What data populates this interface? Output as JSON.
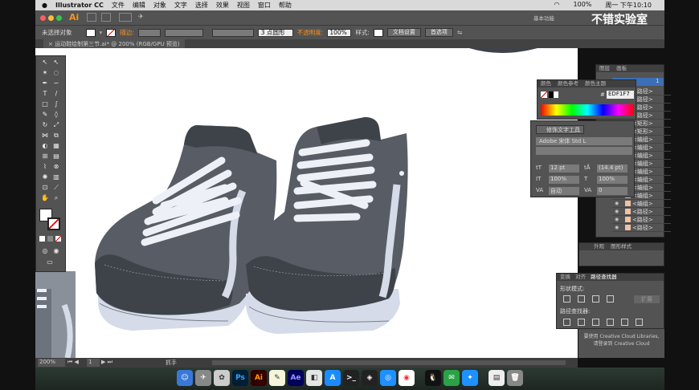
{
  "menubar": {
    "apple": "",
    "app_name": "Illustrator CC",
    "items": [
      "文件",
      "编辑",
      "对象",
      "文字",
      "选择",
      "效果",
      "视图",
      "窗口",
      "帮助"
    ],
    "battery": "100%",
    "clock": "周一 下午10:10"
  },
  "appbar": {
    "logo": "Ai",
    "workspace": "基本功能"
  },
  "control": {
    "selection_label": "未选择对象",
    "stroke_label": "描边:",
    "brush_label": "3 点圆形",
    "opacity_label": "不透明度:",
    "opacity_value": "100%",
    "style_label": "样式:",
    "doc_setup": "文档设置",
    "preferences": "首选项"
  },
  "doc_tab": {
    "title": "运动鞋绘制第三节.ai* @ 200% (RGB/GPU 预览)"
  },
  "color_panel": {
    "tabs": [
      "颜色",
      "颜色参考",
      "颜色主题"
    ],
    "hex_label": "#",
    "hex_value": "EDF1F7"
  },
  "char_panel": {
    "touchup": "修饰文字工具",
    "font": "Adobe 宋体 Std L",
    "size": "12 pt",
    "leading": "(14.4 pt)",
    "scale_v": "100%",
    "scale_h": "100%",
    "kerning": "自动",
    "tracking": "0"
  },
  "layers_panel": {
    "tabs": [
      "图层",
      "画板"
    ],
    "header": "1",
    "rows": [
      "<路径>",
      "<路径>",
      "<路径>",
      "<路径>",
      "<矩形>",
      "<矩形>",
      "<编组>",
      "<编组>",
      "<编组>",
      "<编组>",
      "<编组>",
      "<编组>",
      "<编组>",
      "<编组>",
      "<编组>",
      "<路径>",
      "<路径>",
      "<路径>",
      "<路径>"
    ]
  },
  "transparency_panel": {
    "tabs": [
      "外观",
      "图形样式"
    ]
  },
  "pathfinder_panel": {
    "tabs": [
      "变换",
      "对齐",
      "路径查找器"
    ],
    "shape_modes": "形状模式:",
    "pathfinders": "路径查找器:",
    "expand": "扩展"
  },
  "cc_libraries": {
    "line1": "要使用 Creative Cloud Libraries,",
    "line2": "请登录到 Creative Cloud"
  },
  "statusbar": {
    "zoom": "200%",
    "page": "1",
    "tool": "抓手"
  },
  "dock": {
    "ps": "Ps",
    "ai": "Ai",
    "ae": "Ae"
  },
  "watermark": "不错实验室",
  "colors": {
    "shoe_dark": "#4a4f57",
    "shoe_mid": "#5b616a",
    "lace": "#edf1f7",
    "sole": "#d5dbe8",
    "accent": "#f7931e"
  }
}
